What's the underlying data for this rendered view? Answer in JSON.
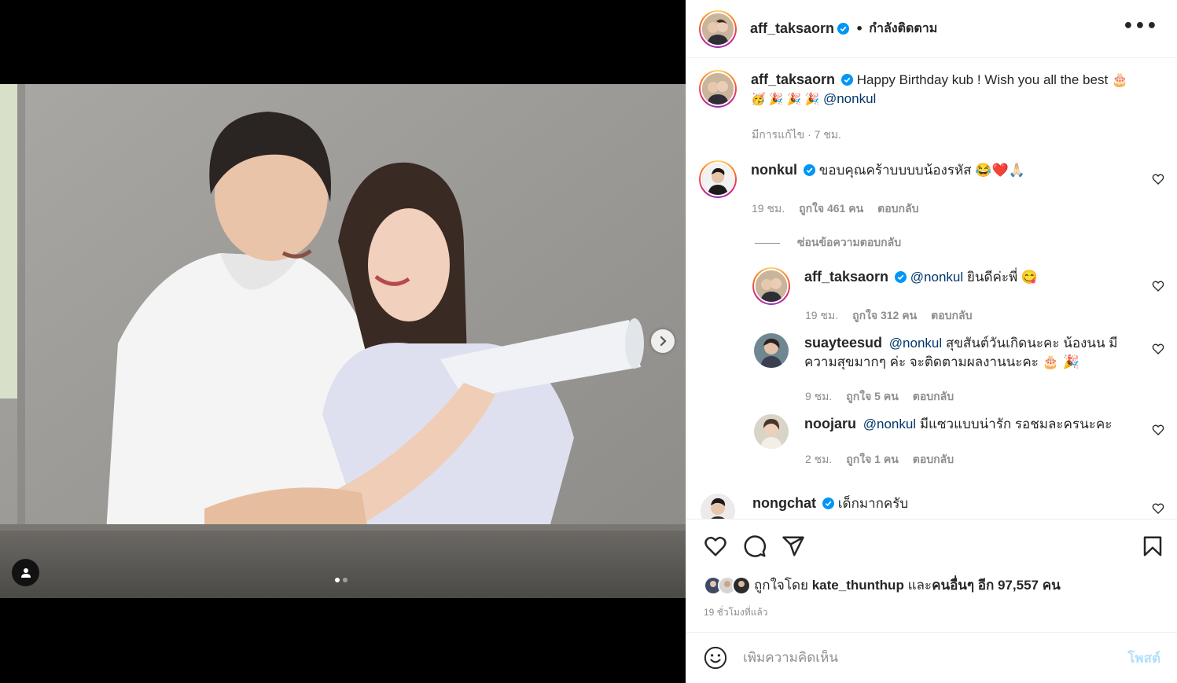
{
  "header": {
    "username": "aff_taksaorn",
    "bullet": "•",
    "follow_status": "กำลังติดตาม",
    "more": "•••"
  },
  "caption": {
    "username": "aff_taksaorn",
    "text": "Happy Birthday kub ! Wish you all the best 🎂",
    "text2": "🥳 🎉 🎉 🎉",
    "mention": "@nonkul",
    "meta": "มีการแก้ไข · 7 ชม."
  },
  "comments": [
    {
      "username": "nonkul",
      "text": "ขอบคุณคร้าบบบบน้องรหัส 😂❤️🙏🏻",
      "time": "19 ชม.",
      "likes": "ถูกใจ 461 คน",
      "reply": "ตอบกลับ"
    }
  ],
  "hide_replies": "ซ่อนข้อความตอบกลับ",
  "replies": [
    {
      "username": "aff_taksaorn",
      "mention": "@nonkul",
      "text": "ยินดีค่ะพี่ 😋",
      "time": "19 ชม.",
      "likes": "ถูกใจ 312 คน",
      "reply": "ตอบกลับ"
    },
    {
      "username": "suayteesud",
      "mention": "@nonkul",
      "text": "สุขสันต์วันเกิดนะคะ น้องนน มี",
      "text2": "ความสุขมากๆ ค่ะ จะติดตามผลงานนะคะ 🎂 🎉",
      "time": "9 ชม.",
      "likes": "ถูกใจ 5 คน",
      "reply": "ตอบกลับ"
    },
    {
      "username": "noojaru",
      "mention": "@nonkul",
      "text": "มีแซวแบบน่ารัก รอชมละครนะคะ",
      "time": "2 ชม.",
      "likes": "ถูกใจ 1 คน",
      "reply": "ตอบกลับ"
    }
  ],
  "last_comment": {
    "username": "nongchat",
    "text": "เด็กมากครับ"
  },
  "actions": {
    "like": "heart-icon",
    "comment": "comment-icon",
    "share": "share-icon",
    "save": "bookmark-icon"
  },
  "likes": {
    "prefix": "ถูกใจโดย",
    "user": "kate_thunthup",
    "middle": "และ",
    "others": "คนอื่นๆ อีก 97,557 คน"
  },
  "time_ago": "19 ชั่วโมงที่แล้ว",
  "add_comment": {
    "placeholder": "เพิ่มความคิดเห็น",
    "post_label": "โพสต์"
  },
  "carousel": {
    "current": 1,
    "total": 2
  },
  "colors": {
    "verified": "#0095f6",
    "mention": "#00376b",
    "muted": "#8e8e8e",
    "post_disabled": "#b2dffc"
  }
}
